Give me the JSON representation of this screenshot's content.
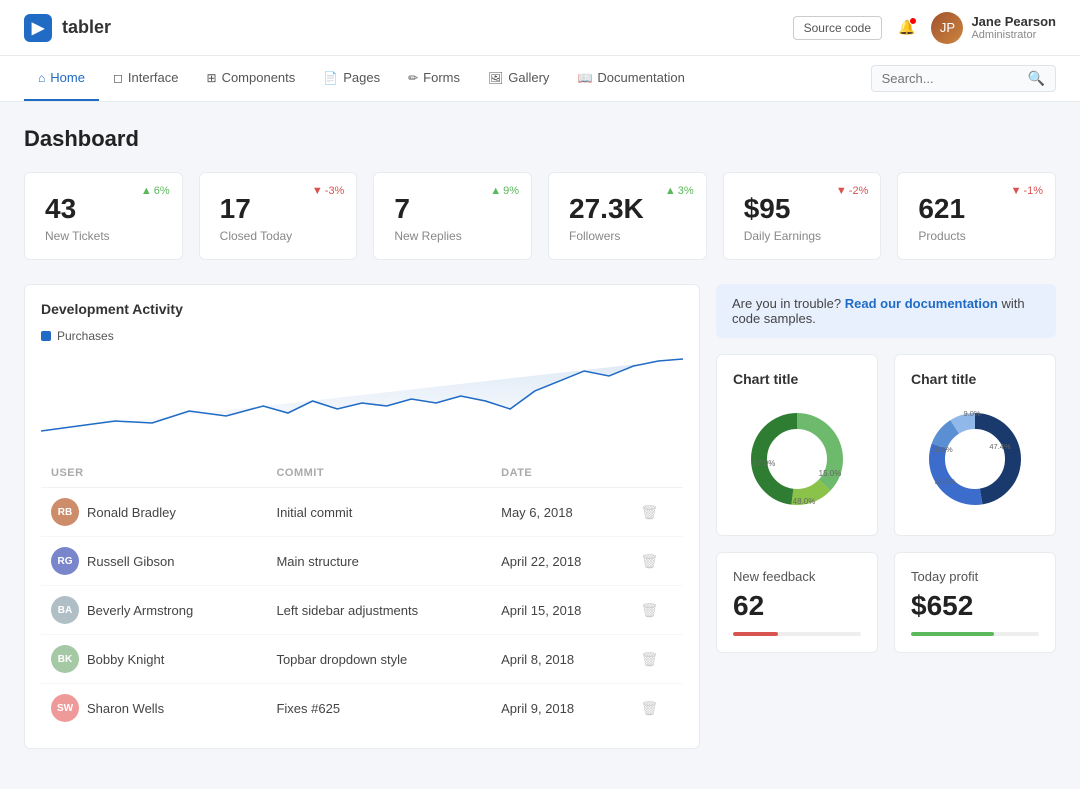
{
  "header": {
    "logo_text": "▶",
    "brand": "tabler",
    "source_code_label": "Source code",
    "user": {
      "name": "Jane Pearson",
      "role": "Administrator",
      "avatar_initials": "JP"
    }
  },
  "nav": {
    "items": [
      {
        "id": "home",
        "label": "Home",
        "icon": "⌂",
        "active": true
      },
      {
        "id": "interface",
        "label": "Interface",
        "icon": "◻",
        "active": false
      },
      {
        "id": "components",
        "label": "Components",
        "icon": "⊞",
        "active": false
      },
      {
        "id": "pages",
        "label": "Pages",
        "icon": "📄",
        "active": false
      },
      {
        "id": "forms",
        "label": "Forms",
        "icon": "✏",
        "active": false
      },
      {
        "id": "gallery",
        "label": "Gallery",
        "icon": "🖼",
        "active": false
      },
      {
        "id": "documentation",
        "label": "Documentation",
        "icon": "📖",
        "active": false
      }
    ],
    "search_placeholder": "Search..."
  },
  "page": {
    "title": "Dashboard"
  },
  "stats": [
    {
      "id": "new-tickets",
      "number": "43",
      "label": "New Tickets",
      "badge": "6%",
      "direction": "up"
    },
    {
      "id": "closed-today",
      "number": "17",
      "label": "Closed Today",
      "badge": "-3%",
      "direction": "down"
    },
    {
      "id": "new-replies",
      "number": "7",
      "label": "New Replies",
      "badge": "9%",
      "direction": "up"
    },
    {
      "id": "followers",
      "number": "27.3K",
      "label": "Followers",
      "badge": "3%",
      "direction": "up"
    },
    {
      "id": "daily-earnings",
      "number": "$95",
      "label": "Daily Earnings",
      "badge": "-2%",
      "direction": "down"
    },
    {
      "id": "products",
      "number": "621",
      "label": "Products",
      "badge": "-1%",
      "direction": "down"
    }
  ],
  "dev_activity": {
    "title": "Development Activity",
    "legend_label": "Purchases"
  },
  "activity_table": {
    "headers": [
      "User",
      "Commit",
      "Date",
      ""
    ],
    "rows": [
      {
        "id": 1,
        "name": "Ronald Bradley",
        "initials": "RB",
        "color": "#cd8c6a",
        "commit": "Initial commit",
        "date": "May 6, 2018"
      },
      {
        "id": 2,
        "name": "Russell Gibson",
        "initials": "RG",
        "color": "#7986cb",
        "commit": "Main structure",
        "date": "April 22, 2018"
      },
      {
        "id": 3,
        "name": "Beverly Armstrong",
        "initials": "BA",
        "color": "#b0bec5",
        "commit": "Left sidebar adjustments",
        "date": "April 15, 2018"
      },
      {
        "id": 4,
        "name": "Bobby Knight",
        "initials": "BK",
        "color": "#a5c8a5",
        "commit": "Topbar dropdown style",
        "date": "April 8, 2018"
      },
      {
        "id": 5,
        "name": "Sharon Wells",
        "initials": "SW",
        "color": "#ef9a9a",
        "commit": "Fixes #625",
        "date": "April 9, 2018"
      }
    ]
  },
  "alert": {
    "text_before": "Are you in trouble?",
    "link_text": "Read our documentation",
    "text_after": "with code samples."
  },
  "chart_left": {
    "title": "Chart title",
    "segments": [
      {
        "label": "37.0%",
        "value": 37,
        "color": "#6dba6d"
      },
      {
        "label": "15.0%",
        "value": 15,
        "color": "#8bc34a"
      },
      {
        "label": "48.0%",
        "value": 48,
        "color": "#2e7d32"
      }
    ]
  },
  "chart_right": {
    "title": "Chart title",
    "segments": [
      {
        "label": "47.4%",
        "value": 47.4,
        "color": "#1a3a6e"
      },
      {
        "label": "33.1%",
        "value": 33.1,
        "color": "#3d6dcc"
      },
      {
        "label": "10.5%",
        "value": 10.5,
        "color": "#5b8fd4"
      },
      {
        "label": "9.0%",
        "value": 9,
        "color": "#90b8e8"
      }
    ]
  },
  "new_feedback": {
    "label": "New feedback",
    "value": "62",
    "progress": 35,
    "progress_color": "#d9534f"
  },
  "today_profit": {
    "label": "Today profit",
    "value": "$652",
    "progress": 65,
    "progress_color": "#5cb85c"
  },
  "colors": {
    "accent": "#206bc4",
    "up": "#5cb85c",
    "down": "#d9534f"
  }
}
